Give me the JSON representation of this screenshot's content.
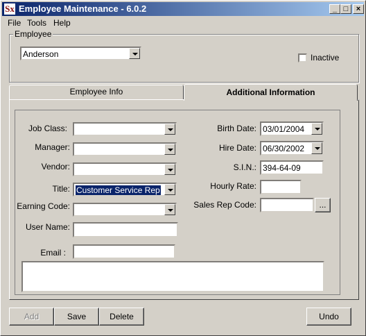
{
  "window": {
    "title": "Employee Maintenance - 6.0.2",
    "app_icon": "Sx"
  },
  "menu": {
    "items": [
      "File",
      "Tools",
      "Help"
    ]
  },
  "employee_group": {
    "legend": "Employee",
    "selected_employee": "Anderson",
    "inactive_label": "Inactive",
    "inactive_checked": false
  },
  "tabs": [
    {
      "label": "Employee Info",
      "active": false
    },
    {
      "label": "Additional Information",
      "active": true
    }
  ],
  "fields": {
    "job_class": {
      "label": "Job Class:",
      "value": ""
    },
    "manager": {
      "label": "Manager:",
      "value": ""
    },
    "vendor": {
      "label": "Vendor:",
      "value": ""
    },
    "title": {
      "label": "Title:",
      "value": "Customer Service Rep"
    },
    "earning_code": {
      "label": "Earning Code:",
      "value": ""
    },
    "user_name": {
      "label": "User Name:",
      "value": ""
    },
    "email": {
      "label": "Email :",
      "value": ""
    },
    "birth_date": {
      "label": "Birth Date:",
      "value": "03/01/2004"
    },
    "hire_date": {
      "label": "Hire Date:",
      "value": "06/30/2002"
    },
    "sin": {
      "label": "S.I.N.:",
      "value": "394-64-09"
    },
    "hourly_rate": {
      "label": "Hourly Rate:",
      "value": ""
    },
    "sales_rep_code": {
      "label": "Sales Rep Code:",
      "value": "",
      "browse_label": "..."
    },
    "notes": {
      "value": ""
    }
  },
  "buttons": {
    "add": "Add",
    "save": "Save",
    "delete": "Delete",
    "undo": "Undo"
  },
  "colors": {
    "titlebar_start": "#0a246a",
    "titlebar_end": "#a6caf0",
    "face": "#d4d0c8"
  }
}
